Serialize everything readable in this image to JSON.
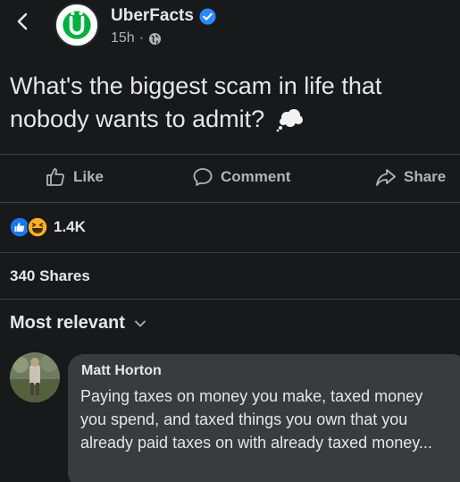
{
  "post": {
    "page_name": "UberFacts",
    "timestamp": "15h",
    "separator": "·",
    "text": "What's the biggest scam in life that nobody wants to admit?"
  },
  "actions": {
    "like_label": "Like",
    "comment_label": "Comment",
    "share_label": "Share"
  },
  "reactions": {
    "count": "1.4K",
    "icons": [
      "like-reaction",
      "haha-reaction"
    ]
  },
  "shares": {
    "label": "340 Shares"
  },
  "comments_filter": {
    "label": "Most relevant"
  },
  "comment": {
    "author": "Matt Horton",
    "text": "Paying taxes on money you make, taxed money you spend, and taxed things you own that you already paid taxes on with already taxed money..."
  },
  "colors": {
    "background": "#18191a",
    "brand_green": "#00b140",
    "verified_blue": "#2d88ff",
    "bubble": "#3a3b3c"
  }
}
